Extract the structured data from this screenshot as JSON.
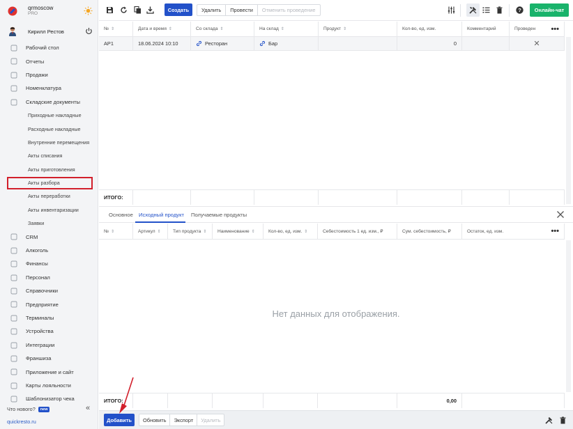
{
  "brand": {
    "name": "qrmoscow",
    "plan": "PRO"
  },
  "user": {
    "name": "Кирилл Рестов"
  },
  "nav": [
    {
      "label": "Рабочий стол",
      "icon": "dashboard-icon"
    },
    {
      "label": "Отчеты",
      "icon": "reports-icon"
    },
    {
      "label": "Продажи",
      "icon": "sales-icon"
    },
    {
      "label": "Номенклатура",
      "icon": "tag-icon"
    },
    {
      "label": "Складские документы",
      "icon": "warehouse-icon"
    }
  ],
  "subnav": [
    "Приходные накладные",
    "Расходные накладные",
    "Внутренние перемещения",
    "Акты списания",
    "Акты приготовления",
    "Акты разбора",
    "Акты переработки",
    "Акты инвентаризации",
    "Заявки"
  ],
  "nav2": [
    {
      "label": "CRM",
      "icon": "crm-icon"
    },
    {
      "label": "Алкоголь",
      "icon": "alcohol-icon"
    },
    {
      "label": "Финансы",
      "icon": "finance-icon"
    },
    {
      "label": "Персонал",
      "icon": "staff-icon"
    },
    {
      "label": "Справочники",
      "icon": "book-icon"
    },
    {
      "label": "Предприятие",
      "icon": "building-icon"
    },
    {
      "label": "Терминалы",
      "icon": "terminal-icon"
    },
    {
      "label": "Устройства",
      "icon": "device-icon"
    },
    {
      "label": "Интеграции",
      "icon": "integration-icon"
    },
    {
      "label": "Франшиза",
      "icon": "franchise-icon"
    },
    {
      "label": "Приложение и сайт",
      "icon": "app-icon"
    },
    {
      "label": "Карты лояльности",
      "icon": "card-icon"
    },
    {
      "label": "Шаблонизатор чека",
      "icon": "receipt-icon"
    }
  ],
  "footer": {
    "whats_new": "Что нового?",
    "new_badge": "new",
    "collapse": "«",
    "site": "quickresto.ru"
  },
  "toolbar": {
    "create": "Создать",
    "delete": "Удалить",
    "post": "Провести",
    "unpost": "Отменить проведение",
    "online_chat": "Онлайн-чат"
  },
  "main_table": {
    "headers": [
      "№",
      "Дата и время",
      "Со склада",
      "На склад",
      "Продукт",
      "Кол-во, ед. изм.",
      "Комментарий",
      "Проведен"
    ],
    "row": {
      "num": "АР1",
      "date": "18.06.2024 10:10",
      "from": "Ресторан",
      "to": "Бар",
      "product": "",
      "qty": "0",
      "comment": "",
      "posted": "✕"
    },
    "total_label": "ИТОГО:"
  },
  "tabs": [
    "Основное",
    "Исходный продукт",
    "Получаемые продукты"
  ],
  "sub_table": {
    "headers": [
      "№",
      "Артикул",
      "Тип продукта",
      "Наименование",
      "Кол-во, ед. изм.",
      "Себестоимость 1 ед. изм., ₽",
      "Сум. себестоимость, ₽",
      "Остаток, ед. изм."
    ],
    "empty": "Нет данных для отображения.",
    "total_label": "ИТОГО:",
    "total_value": "0,00"
  },
  "bottom": {
    "add": "Добавить",
    "refresh": "Обновить",
    "export": "Экспорт",
    "delete": "Удалить"
  },
  "colors": {
    "primary": "#2251c9",
    "online": "#19b36b",
    "highlight": "#d21f2b"
  }
}
